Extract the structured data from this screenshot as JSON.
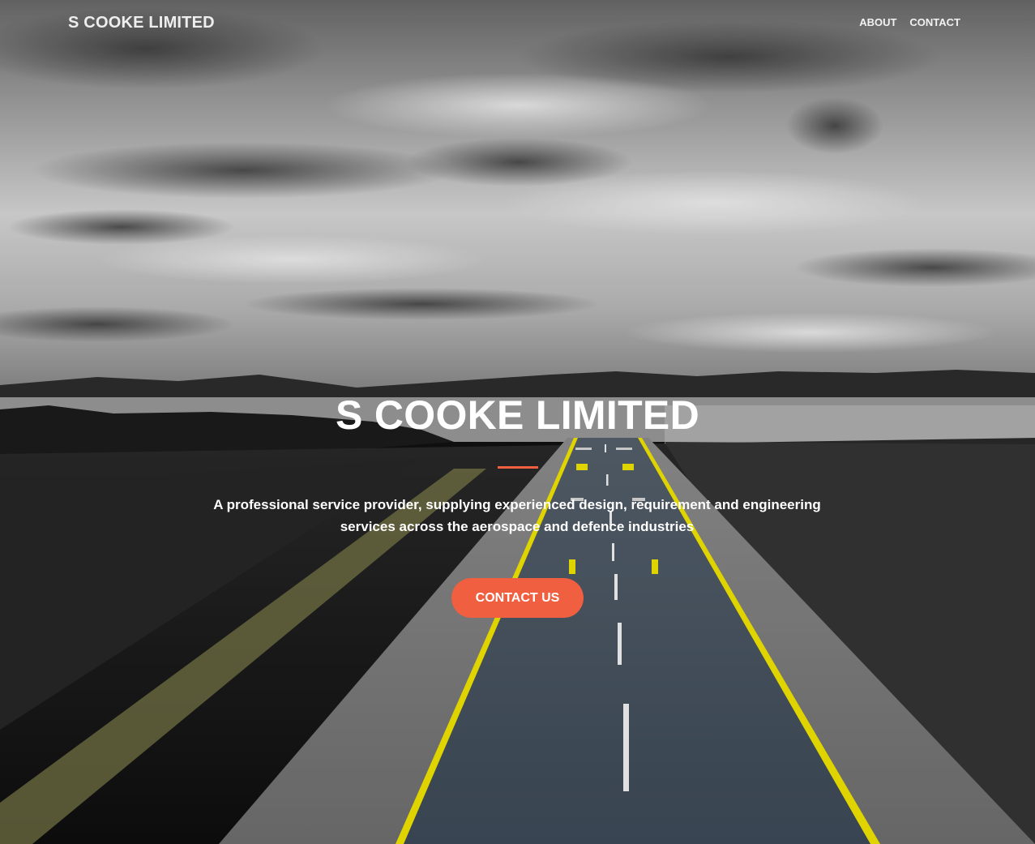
{
  "navbar": {
    "brand": "S COOKE LIMITED",
    "links": [
      {
        "label": "ABOUT"
      },
      {
        "label": "CONTACT"
      }
    ]
  },
  "hero": {
    "title": "S COOKE LIMITED",
    "subtitle": "A professional service provider, supplying experienced design, requirement and engineering services across the aerospace and defence industries",
    "cta_label": "CONTACT US",
    "background": "aerial-runway-photo"
  },
  "colors": {
    "accent": "#f05f40",
    "runway_line": "#f2e600",
    "text": "#ffffff"
  }
}
